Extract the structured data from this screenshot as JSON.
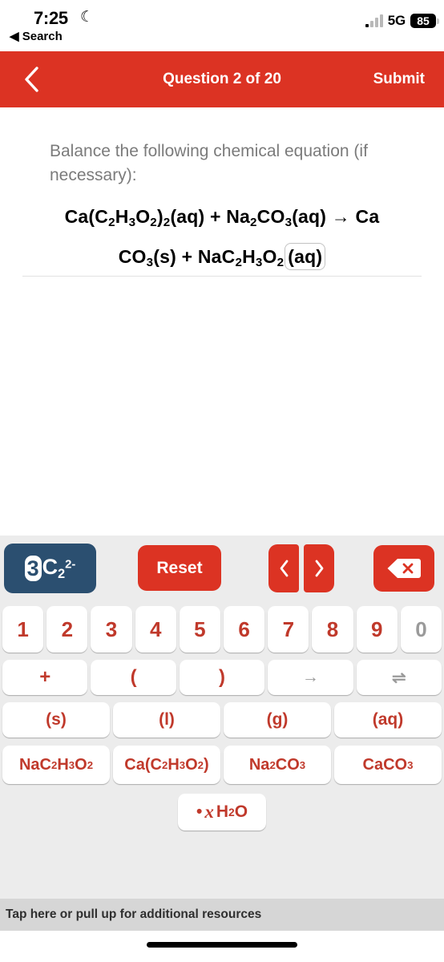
{
  "status_bar": {
    "time": "7:25",
    "moon_icon": "moon-icon",
    "back_label": "Search",
    "network": "5G",
    "battery": "85"
  },
  "header": {
    "back_icon": "chevron-left-icon",
    "title": "Question 2 of 20",
    "submit_label": "Submit",
    "color": "#dc3323"
  },
  "question": {
    "prompt": "Balance the following chemical equation (if necessary):",
    "equation_line1_html": "Ca(C<sub>2</sub>H<sub>3</sub>O<sub>2</sub>)<sub>2</sub>(aq) + Na<sub>2</sub>CO<sub>3</sub>(aq) → Ca",
    "equation_line2_html": "CO<sub>3</sub>(s) + NaC<sub>2</sub>H<sub>3</sub>O<sub>2</sub>",
    "equation_cursor_token": "(aq)"
  },
  "keyboard": {
    "toolbar": {
      "formula_preview": {
        "coefficient": "3",
        "body_html": "C<sub>2</sub><sup>2-</sup>",
        "background": "#2b4f70"
      },
      "reset_label": "Reset",
      "prev_label": "‹",
      "next_label": "›",
      "delete_icon": "backspace-icon"
    },
    "numbers": [
      {
        "label": "1",
        "disabled": false
      },
      {
        "label": "2",
        "disabled": false
      },
      {
        "label": "3",
        "disabled": false
      },
      {
        "label": "4",
        "disabled": false
      },
      {
        "label": "5",
        "disabled": false
      },
      {
        "label": "6",
        "disabled": false
      },
      {
        "label": "7",
        "disabled": false
      },
      {
        "label": "8",
        "disabled": false
      },
      {
        "label": "9",
        "disabled": false
      },
      {
        "label": "0",
        "disabled": true
      }
    ],
    "operators": [
      {
        "label": "+",
        "disabled": false,
        "name": "plus"
      },
      {
        "label": "(",
        "disabled": false,
        "name": "open-paren"
      },
      {
        "label": ")",
        "disabled": false,
        "name": "close-paren"
      },
      {
        "label": "→",
        "disabled": true,
        "name": "yields-arrow"
      },
      {
        "label": "⇌",
        "disabled": true,
        "name": "equilibrium-arrow"
      }
    ],
    "states": [
      {
        "label": "(s)",
        "disabled": false
      },
      {
        "label": "(l)",
        "disabled": false
      },
      {
        "label": "(g)",
        "disabled": false
      },
      {
        "label": "(aq)",
        "disabled": false
      }
    ],
    "formulas": [
      {
        "html": "NaC<sub>2</sub>H<sub>3</sub>O<sub>2</sub>",
        "name": "sodium-acetate"
      },
      {
        "html": "Ca(C<sub>2</sub>H<sub>3</sub>O<sub>2</sub>)",
        "name": "calcium-acetate"
      },
      {
        "html": "Na<sub>2</sub>CO<sub>3</sub>",
        "name": "sodium-carbonate"
      },
      {
        "html": "CaCO<sub>3</sub>",
        "name": "calcium-carbonate"
      }
    ],
    "hydrate": {
      "html": "&bull; <i>x</i> H<sub>2</sub>O",
      "name": "hydrate"
    },
    "accent_color": "#c0392b",
    "disabled_color": "#9a9a9a",
    "background": "#ececec"
  },
  "resources_bar": {
    "label": "Tap here or pull up for additional resources"
  }
}
